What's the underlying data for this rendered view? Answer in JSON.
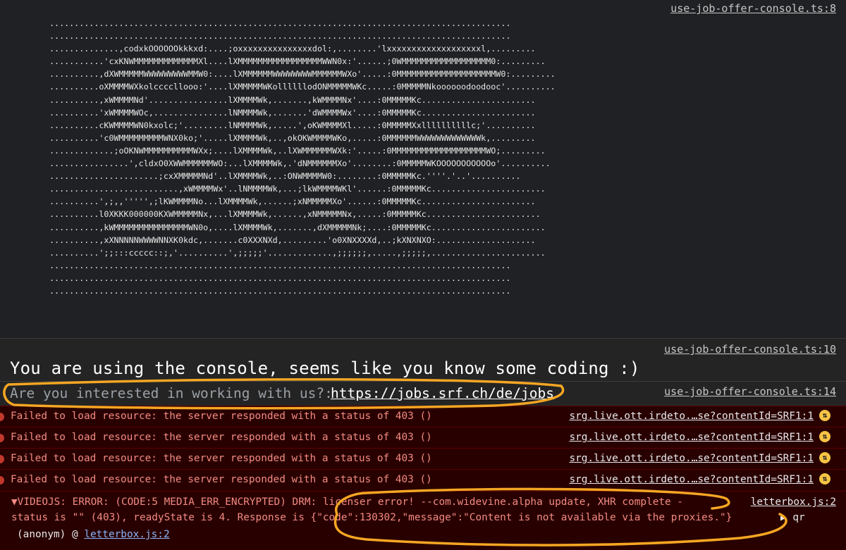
{
  "art_block": {
    "source": "use-job-offer-console.ts:8",
    "lines": [
      ".............................................................................................",
      ".............................................................................................",
      "..............,codxkOOOOOOkkkxd:....;oxxxxxxxxxxxxxxxdol:,........'lxxxxxxxxxxxxxxxxxxxl,.........",
      "...........'cxKNWMMMMMMMMMMMMMXl....lXMMMMMMMMMMMMMMMMMWWN0x:'......;0WMMMMMMMMMMMMMMMMMM0:.........",
      "..........,dXWMMMMMWWWWWWWWWMMW0:....lXMMMMMMWWWWWWWWMMMMMMWXo'.....:0MMMMMMMMMMMMMMMMMMMMW0:.........",
      "..........oXMMMMWXkolccccllooo:'....lXMMMMMWKollllllodONMMMMMWKc.....:0MMMMMNkoooooodoodooc'..........",
      "..........,xWMMMMNd'................lXMMMMWk,.......,kWMMMMNx'....:0MMMMMKc.......................",
      "..........'xWMMMMWOc,...............lNMMMMWk,.......'dWMMMMWx'....:0MMMMMKc.......................",
      "..........cKWMMMMWN0kxolc;'.........lNMMMMWk,.....',oKWMMMMXl.....:0MMMMMXxllllllllllc;'..........",
      "..........'c0WMMMMMMMMMWNX0ko;'.....lXMMMMWk,..,okOKWMMMMWKo,.....:0MMMMMMWWWWWWWWWWWWWk,.........",
      ".............;oOKNWMMMMMMMMMMWXx;....lXMMMMWk,..lXWMMMMMMWXk:'.....:0MMMMMMMMMMMMMMMMMMMWO;.........",
      "................',cldxO0XWWMMMMMMWO:...lXMMMMWk,.'dNMMMMMMXo'........:0MMMMMWKOOOOOOOOOOOo'..........",
      "......................;cxXMMMMMNd'..lXMMMMWk,..:ONWMMMMW0:........:0MMMMMKc.''''.'..'..........",
      "..........................,xWMMMMWx'..lNMMMMWk,...;lkWMMMMWKl'......:0MMMMMKc.......................",
      "..........',;,,''''',;lKWMMMMNo...lXMMMMWk,......;xNMMMMMXo'......:0MMMMMKc.......................",
      "..........l0XKKK000000KXWMMMMMNx,...lXMMMMWk,......,xNMMMMMNx,.....:0MMMMMKc.......................",
      "..........,kWMMMMMMMMMMMMMMMWN0o,....lXMMMMWk,.......,dXMMMMMNk;....:0MMMMMKc.......................",
      "..........,xXNNNNNWWWWNNXK0kdc,.......c0XXXNXd,.........'o0XNXXXXd,..;kXNXNXO:....................",
      "..........';;:::ccccc::;,'..........',;;;;;'.............,;;;;;;,.....,;;;;;,.......................",
      ".............................................................................................",
      ".............................................................................................",
      "............................................................................................."
    ]
  },
  "welcome": {
    "source": "use-job-offer-console.ts:10",
    "text": "You are using the console, seems like you know some coding :)"
  },
  "interest": {
    "source": "use-job-offer-console.ts:14",
    "prefix": "Are you interested in working with us?:",
    "link": "https://jobs.srf.ch/de/jobs"
  },
  "errors": [
    {
      "text": "Failed to load resource: the server responded with a status of 403 ()",
      "source": "srg.live.ott.irdeto.…se?contentId=SRF1:1"
    },
    {
      "text": "Failed to load resource: the server responded with a status of 403 ()",
      "source": "srg.live.ott.irdeto.…se?contentId=SRF1:1"
    },
    {
      "text": "Failed to load resource: the server responded with a status of 403 ()",
      "source": "srg.live.ott.irdeto.…se?contentId=SRF1:1"
    },
    {
      "text": "Failed to load resource: the server responded with a status of 403 ()",
      "source": "srg.live.ott.irdeto.…se?contentId=SRF1:1"
    }
  ],
  "videojs": {
    "line1": "▼VIDEOJS: ERROR: (CODE:5 MEDIA_ERR_ENCRYPTED) DRM: licenser error! --com.widevine.alpha update, XHR complete -",
    "line2": "status is \"\" (403), readyState is 4.  Response is {\"code\":130302,\"message\":\"Content is not available via the proxies.\"}",
    "qr": "▶ qr",
    "line3_prefix": "(anonym) @ ",
    "line3_link": "letterbox.js:2",
    "source": "letterbox.js:2"
  },
  "colors": {
    "background": "#242424",
    "error_background": "#290000",
    "error_text": "#f28b82",
    "annotation": "#f5a623",
    "warning_icon": "#f6c344"
  }
}
